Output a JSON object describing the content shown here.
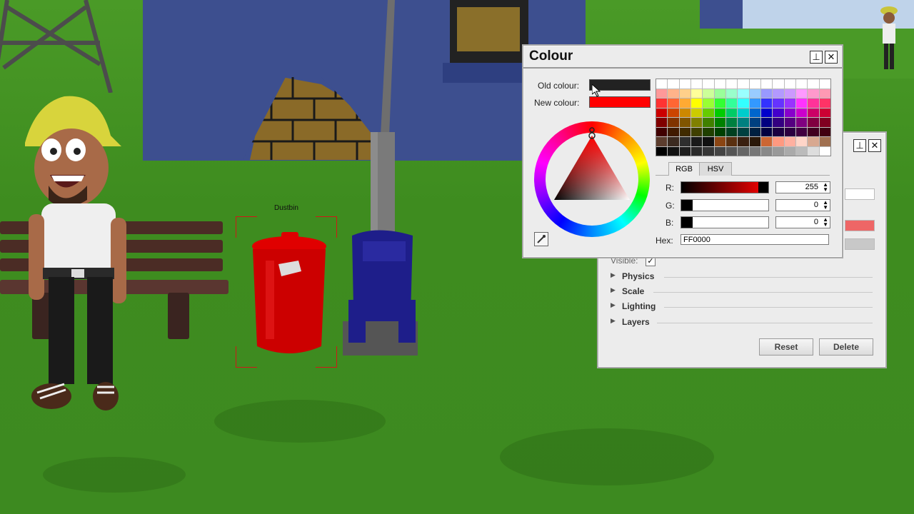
{
  "scene": {
    "object_label": "Dustbin"
  },
  "colour_dialog": {
    "title": "Colour",
    "old_colour_label": "Old colour:",
    "new_colour_label": "New colour:",
    "old_colour": "#222222",
    "new_colour": "#ff0000",
    "tabs": [
      "RGB",
      "HSV"
    ],
    "active_tab": "RGB",
    "r_label": "R:",
    "g_label": "G:",
    "b_label": "B:",
    "r_value": "255",
    "g_value": "0",
    "b_value": "0",
    "hex_label": "Hex:",
    "hex_value": "FF0000",
    "palette": [
      [
        "#ffffff",
        "#ffffff",
        "#ffffff",
        "#ffffff",
        "#ffffff",
        "#ffffff",
        "#ffffff",
        "#ffffff",
        "#ffffff",
        "#ffffff",
        "#ffffff",
        "#ffffff",
        "#ffffff",
        "#ffffff",
        "#ffffff"
      ],
      [
        "#ff9999",
        "#ffb38a",
        "#ffd08a",
        "#ffff99",
        "#ccff99",
        "#99ff99",
        "#99ffcc",
        "#99ffff",
        "#99ccff",
        "#9999ff",
        "#b399ff",
        "#cc99ff",
        "#ff99ff",
        "#ff99cc",
        "#ff99b3"
      ],
      [
        "#ff3333",
        "#ff6633",
        "#ffaa33",
        "#ffff00",
        "#99ff33",
        "#33ff33",
        "#33ff99",
        "#33ffff",
        "#3399ff",
        "#3333ff",
        "#6633ff",
        "#9933ff",
        "#ff33ff",
        "#ff3399",
        "#ff3366"
      ],
      [
        "#cc0000",
        "#cc4400",
        "#cc8800",
        "#cccc00",
        "#66cc00",
        "#00cc00",
        "#00cc66",
        "#00cccc",
        "#0066cc",
        "#0000cc",
        "#4400cc",
        "#8800cc",
        "#cc00cc",
        "#cc0066",
        "#cc0033"
      ],
      [
        "#800000",
        "#803300",
        "#805500",
        "#808000",
        "#408000",
        "#008000",
        "#008040",
        "#008080",
        "#004080",
        "#000080",
        "#330080",
        "#550080",
        "#800080",
        "#800040",
        "#800020"
      ],
      [
        "#400000",
        "#401a00",
        "#402b00",
        "#404000",
        "#204000",
        "#004000",
        "#004020",
        "#004040",
        "#002040",
        "#000040",
        "#1a0040",
        "#2b0040",
        "#400040",
        "#400020",
        "#400010"
      ],
      [
        "#5c3d2e",
        "#3b2a20",
        "#2e2e2e",
        "#1a1a1a",
        "#101010",
        "#8b4513",
        "#5a3010",
        "#3a2010",
        "#2a1808",
        "#cc6633",
        "#ff9980",
        "#ffb0a0",
        "#ffd5c8",
        "#d8a890",
        "#a07050"
      ],
      [
        "#000000",
        "#111111",
        "#1e1e1e",
        "#2a2a2a",
        "#363636",
        "#444444",
        "#555555",
        "#666666",
        "#777777",
        "#888888",
        "#999999",
        "#aaaaaa",
        "#bbbbbb",
        "#dddddd",
        "#ffffff"
      ]
    ]
  },
  "properties_panel": {
    "visible_label": "Visible:",
    "sections": [
      "Physics",
      "Scale",
      "Lighting",
      "Layers"
    ],
    "reset_button": "Reset",
    "delete_button": "Delete",
    "colour_swatch": "#ee6666"
  }
}
